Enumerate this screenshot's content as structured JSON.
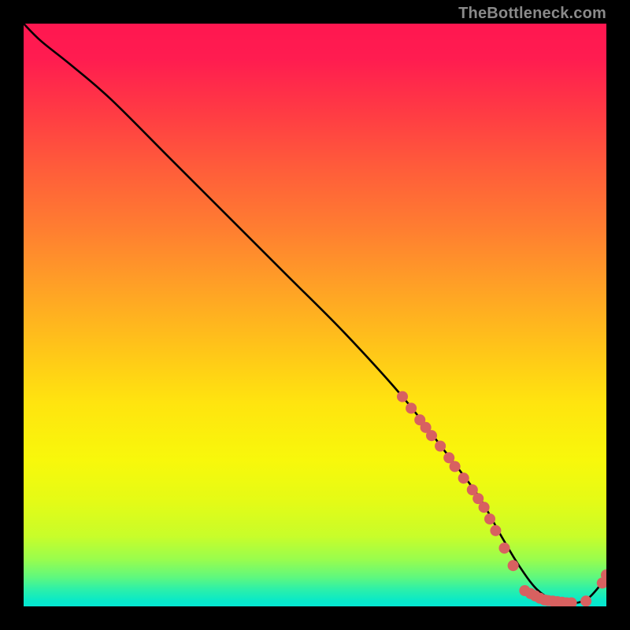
{
  "watermark": "TheBottleneck.com",
  "chart_data": {
    "type": "line",
    "title": "",
    "xlabel": "",
    "ylabel": "",
    "xlim": [
      0,
      100
    ],
    "ylim": [
      0,
      100
    ],
    "line": {
      "x": [
        0,
        3,
        8,
        15,
        25,
        35,
        45,
        55,
        65,
        72,
        78,
        82,
        85,
        88,
        91,
        94,
        97,
        100
      ],
      "y": [
        100,
        97,
        93,
        87,
        77,
        67,
        57,
        47,
        36,
        27,
        19,
        12,
        7,
        3,
        1,
        0.5,
        1.5,
        5
      ]
    },
    "markers": [
      {
        "x": 65.0,
        "y": 36.0
      },
      {
        "x": 66.5,
        "y": 34.0
      },
      {
        "x": 68.0,
        "y": 32.0
      },
      {
        "x": 69.0,
        "y": 30.7
      },
      {
        "x": 70.0,
        "y": 29.3
      },
      {
        "x": 71.5,
        "y": 27.5
      },
      {
        "x": 73.0,
        "y": 25.5
      },
      {
        "x": 74.0,
        "y": 24.0
      },
      {
        "x": 75.5,
        "y": 22.0
      },
      {
        "x": 77.0,
        "y": 20.0
      },
      {
        "x": 78.0,
        "y": 18.5
      },
      {
        "x": 79.0,
        "y": 17.0
      },
      {
        "x": 80.0,
        "y": 15.0
      },
      {
        "x": 81.0,
        "y": 13.0
      },
      {
        "x": 82.5,
        "y": 10.0
      },
      {
        "x": 84.0,
        "y": 7.0
      },
      {
        "x": 86.0,
        "y": 2.7
      },
      {
        "x": 87.0,
        "y": 2.2
      },
      {
        "x": 87.8,
        "y": 1.8
      },
      {
        "x": 88.6,
        "y": 1.4
      },
      {
        "x": 89.4,
        "y": 1.1
      },
      {
        "x": 90.0,
        "y": 1.0
      },
      {
        "x": 90.8,
        "y": 0.9
      },
      {
        "x": 91.6,
        "y": 0.8
      },
      {
        "x": 92.4,
        "y": 0.7
      },
      {
        "x": 93.2,
        "y": 0.6
      },
      {
        "x": 94.0,
        "y": 0.6
      },
      {
        "x": 96.5,
        "y": 0.9
      },
      {
        "x": 99.3,
        "y": 4.0
      },
      {
        "x": 100.0,
        "y": 5.4
      }
    ]
  }
}
